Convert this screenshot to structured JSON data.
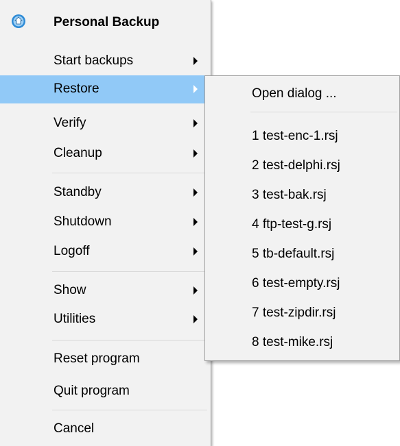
{
  "menu": {
    "title": "Personal Backup",
    "items": [
      {
        "label": "Start backups",
        "has_submenu": true
      },
      {
        "label": "Restore",
        "has_submenu": true,
        "highlighted": true
      },
      {
        "label": "Verify",
        "has_submenu": true
      },
      {
        "label": "Cleanup",
        "has_submenu": true
      },
      {
        "label": "Standby",
        "has_submenu": true
      },
      {
        "label": "Shutdown",
        "has_submenu": true
      },
      {
        "label": "Logoff",
        "has_submenu": true
      },
      {
        "label": "Show",
        "has_submenu": true
      },
      {
        "label": "Utilities",
        "has_submenu": true
      },
      {
        "label": "Reset program",
        "has_submenu": false
      },
      {
        "label": "Quit program",
        "has_submenu": false
      },
      {
        "label": "Cancel",
        "has_submenu": false
      }
    ]
  },
  "submenu": {
    "items": [
      {
        "label": "Open dialog ..."
      },
      {
        "label": "1 test-enc-1.rsj"
      },
      {
        "label": "2 test-delphi.rsj"
      },
      {
        "label": "3 test-bak.rsj"
      },
      {
        "label": "4 ftp-test-g.rsj"
      },
      {
        "label": "5 tb-default.rsj"
      },
      {
        "label": "6 test-empty.rsj"
      },
      {
        "label": "7 test-zipdir.rsj"
      },
      {
        "label": "8 test-mike.rsj"
      }
    ]
  },
  "colors": {
    "menu_background": "#f2f2f2",
    "highlight": "#91c9f7",
    "separator": "#d7d7d7",
    "icon_blue": "#2e8bd6"
  },
  "icons": {
    "app": "personal-backup-app-icon",
    "submenu_arrow": "chevron-right-icon"
  }
}
